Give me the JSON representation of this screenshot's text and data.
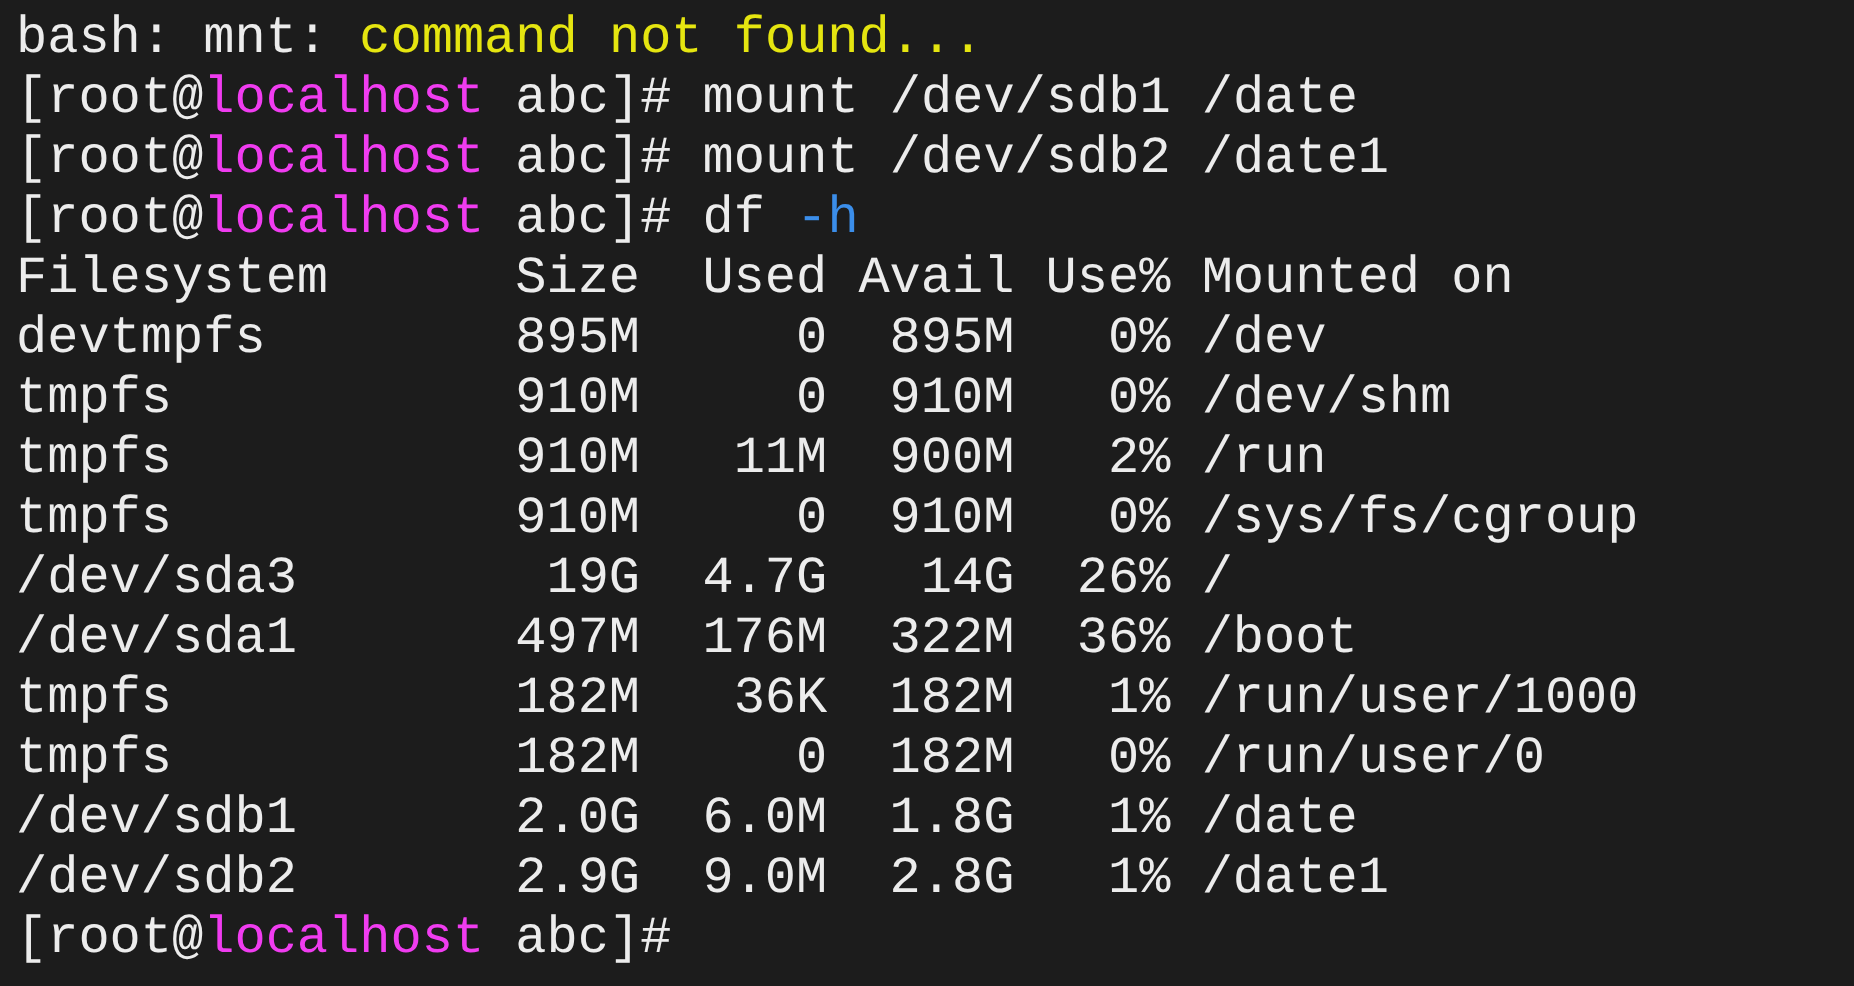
{
  "terminal": {
    "lines": [
      {
        "kind": "error",
        "prefix": "bash: mnt: ",
        "message": "command not found..."
      },
      {
        "kind": "prompt",
        "before": "[root@",
        "host": "localhost",
        "after": " abc]# ",
        "command": "mount /dev/sdb1 /date"
      },
      {
        "kind": "prompt",
        "before": "[root@",
        "host": "localhost",
        "after": " abc]# ",
        "command": "mount /dev/sdb2 /date1"
      },
      {
        "kind": "prompt",
        "before": "[root@",
        "host": "localhost",
        "after": " abc]# ",
        "command": "df ",
        "option": "-h"
      }
    ],
    "df_output": {
      "columns": [
        "Filesystem",
        "Size",
        "Used",
        "Avail",
        "Use%",
        "Mounted on"
      ],
      "rows": [
        [
          "devtmpfs",
          "895M",
          "0",
          "895M",
          "0%",
          "/dev"
        ],
        [
          "tmpfs",
          "910M",
          "0",
          "910M",
          "0%",
          "/dev/shm"
        ],
        [
          "tmpfs",
          "910M",
          "11M",
          "900M",
          "2%",
          "/run"
        ],
        [
          "tmpfs",
          "910M",
          "0",
          "910M",
          "0%",
          "/sys/fs/cgroup"
        ],
        [
          "/dev/sda3",
          "19G",
          "4.7G",
          "14G",
          "26%",
          "/"
        ],
        [
          "/dev/sda1",
          "497M",
          "176M",
          "322M",
          "36%",
          "/boot"
        ],
        [
          "tmpfs",
          "182M",
          "36K",
          "182M",
          "1%",
          "/run/user/1000"
        ],
        [
          "tmpfs",
          "182M",
          "0",
          "182M",
          "0%",
          "/run/user/0"
        ],
        [
          "/dev/sdb1",
          "2.0G",
          "6.0M",
          "1.8G",
          "1%",
          "/date"
        ],
        [
          "/dev/sdb2",
          "2.9G",
          "9.0M",
          "2.8G",
          "1%",
          "/date1"
        ]
      ]
    },
    "final_prompt": {
      "before": "[root@",
      "host": "localhost",
      "after": " abc]#"
    }
  }
}
